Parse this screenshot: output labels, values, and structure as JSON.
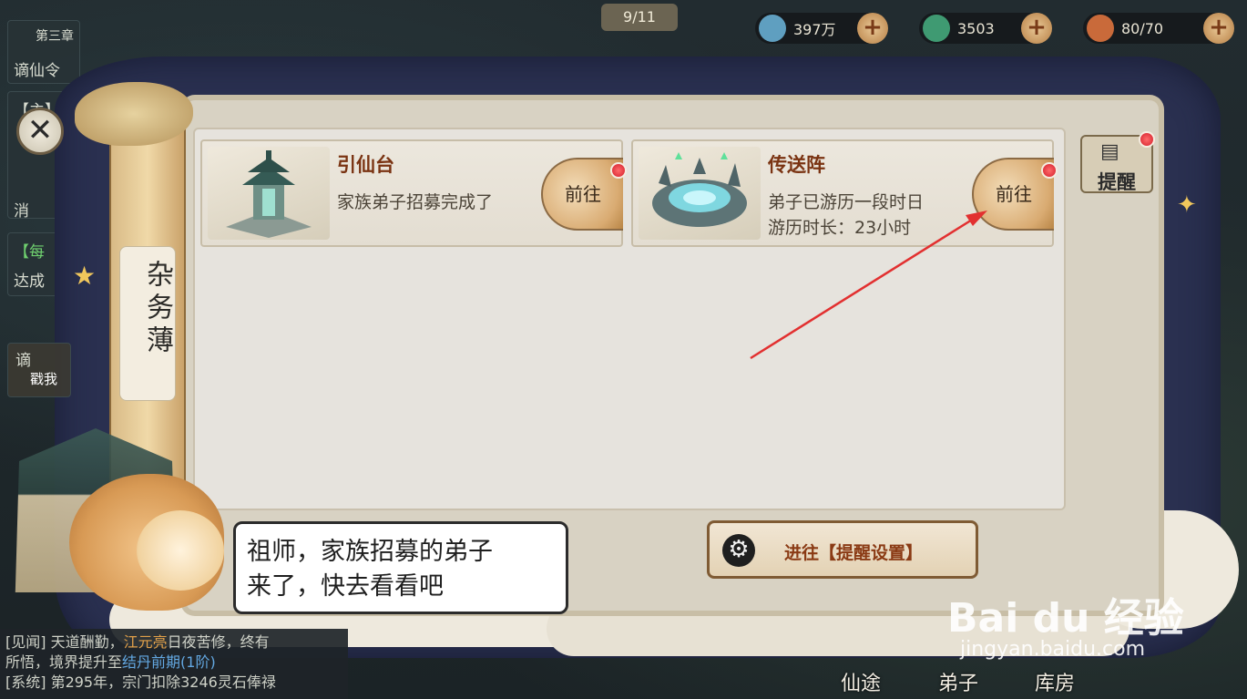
{
  "top_bar": {
    "page_indicator": "9/11",
    "resources": [
      {
        "name": "spirit-stone",
        "value": "397万",
        "color": "#5f9fc0"
      },
      {
        "name": "jade",
        "value": "3503",
        "color": "#3f9a72"
      },
      {
        "name": "stamina",
        "value": "80/70",
        "color": "#c96a3a"
      }
    ]
  },
  "background": {
    "left_panel_1": "第三章",
    "left_panel_1b": "谪仙令",
    "left_panel_2": "【主】",
    "left_panel_2b": "消",
    "left_panel_3": "【每",
    "left_panel_3b": "达成",
    "side_badge": "戳我",
    "side_badge_2": "谪",
    "bottom_nav": [
      "仙途",
      "弟子",
      "库房"
    ]
  },
  "log": {
    "line1_prefix": "[见闻] 天道酬勤，",
    "line1_name": "江元亮",
    "line1_suffix": "日夜苦修，终有",
    "line2_prefix": "所悟，境界提升至",
    "line2_realm": "结丹前期(1阶)",
    "line3": "[系统] 第295年，宗门扣除3246灵石俸禄"
  },
  "dialog": {
    "close_symbol": "✕",
    "scroll_title": "杂务薄",
    "reminder_tab": {
      "icon": "▤",
      "label": "提醒"
    },
    "tasks": [
      {
        "title": "引仙台",
        "line1": "家族弟子招募完成了",
        "line2": "",
        "button": "前往"
      },
      {
        "title": "传送阵",
        "line1": "弟子已游历一段时日",
        "line2": "游历时长：23小时",
        "button": "前往"
      }
    ],
    "settings_button": "进往【提醒设置】",
    "speech_line1": "祖师，家族招募的弟子",
    "speech_line2": "来了，快去看看吧"
  },
  "watermark": {
    "brand": "Bai du 经验",
    "url": "jingyan.baidu.com"
  },
  "colors": {
    "accent_red": "#e23030",
    "title_brown": "#7a3312",
    "notification_red": "#d41f2c"
  }
}
